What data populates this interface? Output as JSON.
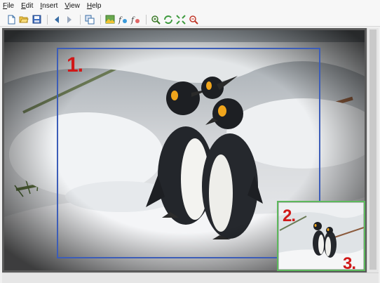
{
  "menu": {
    "file": {
      "label": "File",
      "accel": "F",
      "rest": "ile"
    },
    "edit": {
      "label": "Edit",
      "accel": "E",
      "rest": "dit"
    },
    "insert": {
      "label": "Insert",
      "accel": "I",
      "rest": "nsert"
    },
    "view": {
      "label": "View",
      "accel": "V",
      "rest": "iew"
    },
    "help": {
      "label": "Help",
      "accel": "H",
      "rest": "elp"
    }
  },
  "toolbar": {
    "icons": [
      "new-icon",
      "open-icon",
      "save-icon",
      "back-icon",
      "forward-icon",
      "copy-icon",
      "image-icon",
      "fx-icon",
      "fx2-icon",
      "zoom-in-icon",
      "refresh-icon",
      "fit-icon",
      "zoom-out-icon"
    ]
  },
  "callouts": {
    "one": "1.",
    "two": "2.",
    "three": "3."
  },
  "colors": {
    "selection": "#3c5db8",
    "thumbnail_frame": "#5db85d",
    "callout": "#d01818"
  }
}
